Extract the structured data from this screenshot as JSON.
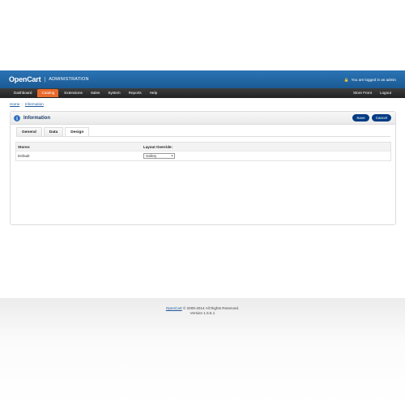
{
  "header": {
    "brand": "OpenCart",
    "area": "ADMINISTRATION",
    "login_text": "You are logged in as admin",
    "lock_icon": "lock-icon"
  },
  "menu": {
    "left": [
      "Dashboard",
      "Catalog",
      "Extensions",
      "Sales",
      "System",
      "Reports",
      "Help"
    ],
    "active_index": 1,
    "right": [
      "Store Front",
      "Logout"
    ]
  },
  "breadcrumb": {
    "home": "Home",
    "separator": "::",
    "current": "Information"
  },
  "box": {
    "title": "Information",
    "info_icon": "info-icon",
    "save_label": "Save",
    "cancel_label": "Cancel",
    "tabs": [
      "General",
      "Data",
      "Design"
    ],
    "selected_tab": 2
  },
  "grid": {
    "headers": [
      "Stores:",
      "Layout Override:"
    ],
    "rows": [
      {
        "store": "Default",
        "layout": "Gallery"
      }
    ]
  },
  "footer": {
    "link": "OpenCart",
    "copyright": " © 2009-2014 All Rights Reserved.",
    "version": "Version 1.5.6.1"
  },
  "colors": {
    "header_blue": "#1f65a3",
    "menu_dark": "#2f2f2f",
    "active_orange": "#e86a2b",
    "button_navy": "#003b82",
    "link_blue": "#1e5a9a"
  }
}
